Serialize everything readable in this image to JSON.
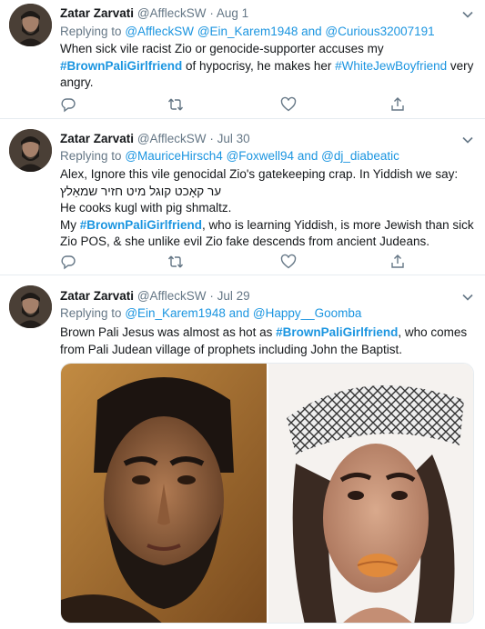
{
  "tweets": [
    {
      "name": "Zatar Zarvati",
      "handle": "@AffleckSW",
      "dot": "·",
      "date": "Aug 1",
      "replying_prefix": "Replying to",
      "replying_to": [
        "@AffleckSW",
        "@Ein_Karem1948",
        "and",
        "@Curious32007191"
      ],
      "body": {
        "t1": "When sick vile racist Zio or genocide-supporter accuses my",
        "h1": "#BrownPaliGirlfriend",
        "t2": " of hypocrisy, he makes her ",
        "h2": "#WhiteJewBoyfriend",
        "t3": " very",
        "t4": "angry."
      }
    },
    {
      "name": "Zatar Zarvati",
      "handle": "@AffleckSW",
      "dot": "·",
      "date": "Jul 30",
      "replying_prefix": "Replying to",
      "replying_to": [
        "@MauriceHirsch4",
        "@Foxwell94",
        "and",
        "@dj_diabeatic"
      ],
      "body": {
        "l1": "Alex, Ignore this vile genocidal Zio's gatekeeping crap. In Yiddish we say:",
        "l2": "ער קאָכט קוגל מיט חזיר שמאַלץ",
        "l3": "He cooks kugl with pig shmaltz.",
        "l4a": "My ",
        "h1": "#BrownPaliGirlfriend",
        "l4b": ", who is learning Yiddish, is more Jewish than sick",
        "l5": "Zio POS, & she unlike evil Zio fake descends from ancient Judeans."
      }
    },
    {
      "name": "Zatar Zarvati",
      "handle": "@AffleckSW",
      "dot": "·",
      "date": "Jul 29",
      "replying_prefix": "Replying to",
      "replying_to": [
        "@Ein_Karem1948",
        "and",
        "@Happy__Goomba"
      ],
      "body": {
        "t1": "Brown Pali Jesus was almost as hot as ",
        "h1": "#BrownPaliGirlfriend",
        "t2": ", who comes",
        "t3": "from Pali Judean village of prophets including John the Baptist."
      },
      "media": [
        "portrait-of-bearded-man",
        "selfie-of-woman-in-keffiyeh"
      ]
    }
  ],
  "actions": [
    "reply-icon",
    "retweet-icon",
    "like-icon",
    "share-icon"
  ],
  "colors": {
    "link": "#1b95e0",
    "muted": "#657786",
    "text": "#14171a",
    "divider": "#e6ecf0"
  }
}
